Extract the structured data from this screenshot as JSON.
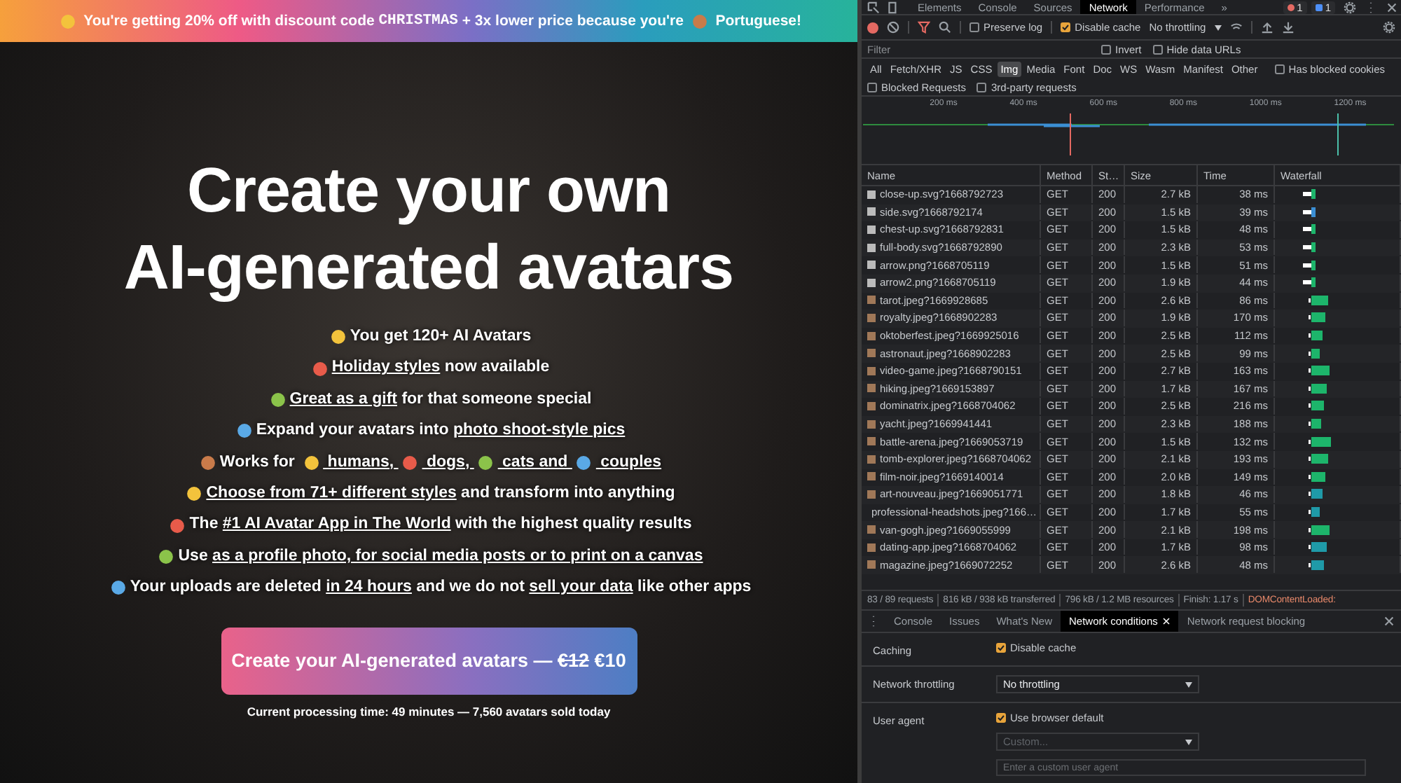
{
  "promo_banner": {
    "segments": [
      {
        "kind": "emoji"
      },
      {
        "kind": "text",
        "text": " You're getting 20% off with discount code "
      },
      {
        "kind": "code",
        "text": "CHRISTMAS"
      },
      {
        "kind": "text",
        "text": " + 3x lower price because you're "
      },
      {
        "kind": "emoji"
      },
      {
        "kind": "text",
        "text": " Portuguese!"
      }
    ]
  },
  "hero": {
    "title_lines": [
      "Create your own",
      "AI-generated avatars"
    ],
    "features": [
      {
        "segments": [
          {
            "kind": "text",
            "text": "You get 120+ AI Avatars"
          }
        ]
      },
      {
        "segments": [
          {
            "kind": "link",
            "text": "Holiday styles"
          },
          {
            "kind": "text",
            "text": " now available"
          }
        ]
      },
      {
        "segments": [
          {
            "kind": "link",
            "text": "Great as a gift"
          },
          {
            "kind": "text",
            "text": " for that someone special"
          }
        ]
      },
      {
        "segments": [
          {
            "kind": "text",
            "text": "Expand your avatars into "
          },
          {
            "kind": "link",
            "text": "photo shoot-style pics"
          }
        ]
      },
      {
        "segments": [
          {
            "kind": "text",
            "text": "Works for "
          },
          {
            "kind": "emoji"
          },
          {
            "kind": "link",
            "text": " humans, "
          },
          {
            "kind": "emoji"
          },
          {
            "kind": "link",
            "text": " dogs, "
          },
          {
            "kind": "emoji"
          },
          {
            "kind": "link",
            "text": " cats and "
          },
          {
            "kind": "emoji"
          },
          {
            "kind": "link",
            "text": " couples"
          }
        ]
      },
      {
        "segments": [
          {
            "kind": "link",
            "text": "Choose from 71+ different styles"
          },
          {
            "kind": "text",
            "text": " and transform into anything"
          }
        ]
      },
      {
        "segments": [
          {
            "kind": "text",
            "text": "The "
          },
          {
            "kind": "link",
            "text": "#1 AI Avatar App in The World"
          },
          {
            "kind": "text",
            "text": " with the highest quality results"
          }
        ]
      },
      {
        "segments": [
          {
            "kind": "text",
            "text": "Use "
          },
          {
            "kind": "link",
            "text": "as a profile photo, for social media posts or to print on a canvas"
          }
        ]
      },
      {
        "segments": [
          {
            "kind": "text",
            "text": "Your uploads are deleted "
          },
          {
            "kind": "link",
            "text": "in 24 hours"
          },
          {
            "kind": "text",
            "text": " and we do not "
          },
          {
            "kind": "link",
            "text": "sell your data"
          },
          {
            "kind": "text",
            "text": " like other apps"
          }
        ]
      }
    ],
    "cta_button": {
      "segments": [
        {
          "kind": "text",
          "text": "Create your AI-generated avatars — "
        },
        {
          "kind": "strike",
          "text": "€12"
        },
        {
          "kind": "text",
          "text": " €10"
        }
      ]
    },
    "note": "Current processing time: 49 minutes — 7,560 avatars sold today"
  },
  "devtools": {
    "tabs": [
      {
        "label": "Elements",
        "selected": false
      },
      {
        "label": "Console",
        "selected": false
      },
      {
        "label": "Sources",
        "selected": false
      },
      {
        "label": "Network",
        "selected": true
      },
      {
        "label": "Performance",
        "selected": false
      }
    ],
    "more_tabs": "»",
    "error_count": "1",
    "message_count": "1",
    "toolbar": {
      "preserve_log": {
        "label": "Preserve log",
        "checked": false
      },
      "disable_cache": {
        "label": "Disable cache",
        "checked": true
      },
      "throttling": "No throttling"
    },
    "filter": {
      "placeholder": "Filter",
      "invert": {
        "label": "Invert",
        "checked": false
      },
      "hide_data_urls": {
        "label": "Hide data URLs",
        "checked": false
      }
    },
    "type_filters": [
      {
        "label": "All",
        "selected": false
      },
      {
        "label": "Fetch/XHR",
        "selected": false
      },
      {
        "label": "JS",
        "selected": false
      },
      {
        "label": "CSS",
        "selected": false
      },
      {
        "label": "Img",
        "selected": true
      },
      {
        "label": "Media",
        "selected": false
      },
      {
        "label": "Font",
        "selected": false
      },
      {
        "label": "Doc",
        "selected": false
      },
      {
        "label": "WS",
        "selected": false
      },
      {
        "label": "Wasm",
        "selected": false
      },
      {
        "label": "Manifest",
        "selected": false
      },
      {
        "label": "Other",
        "selected": false
      }
    ],
    "has_blocked_cookies": {
      "label": "Has blocked cookies",
      "checked": false
    },
    "blocked_requests": {
      "label": "Blocked Requests",
      "checked": false
    },
    "third_party": {
      "label": "3rd-party requests",
      "checked": false
    },
    "timeline_ticks": [
      "200 ms",
      "400 ms",
      "600 ms",
      "800 ms",
      "1000 ms",
      "1200 ms"
    ],
    "table": {
      "columns": [
        "Name",
        "Method",
        "St…",
        "Size",
        "Time",
        "Waterfall"
      ],
      "rows": [
        {
          "name": "close-up.svg?1668792723",
          "method": "GET",
          "status": "200",
          "size": "2.7 kB",
          "time": "38 ms"
        },
        {
          "name": "side.svg?1668792174",
          "method": "GET",
          "status": "200",
          "size": "1.5 kB",
          "time": "39 ms"
        },
        {
          "name": "chest-up.svg?1668792831",
          "method": "GET",
          "status": "200",
          "size": "1.5 kB",
          "time": "48 ms"
        },
        {
          "name": "full-body.svg?1668792890",
          "method": "GET",
          "status": "200",
          "size": "2.3 kB",
          "time": "53 ms"
        },
        {
          "name": "arrow.png?1668705119",
          "method": "GET",
          "status": "200",
          "size": "1.5 kB",
          "time": "51 ms"
        },
        {
          "name": "arrow2.png?1668705119",
          "method": "GET",
          "status": "200",
          "size": "1.9 kB",
          "time": "44 ms"
        },
        {
          "name": "tarot.jpeg?1669928685",
          "method": "GET",
          "status": "200",
          "size": "2.6 kB",
          "time": "86 ms"
        },
        {
          "name": "royalty.jpeg?1668902283",
          "method": "GET",
          "status": "200",
          "size": "1.9 kB",
          "time": "170 ms"
        },
        {
          "name": "oktoberfest.jpeg?1669925016",
          "method": "GET",
          "status": "200",
          "size": "2.5 kB",
          "time": "112 ms"
        },
        {
          "name": "astronaut.jpeg?1668902283",
          "method": "GET",
          "status": "200",
          "size": "2.5 kB",
          "time": "99 ms"
        },
        {
          "name": "video-game.jpeg?1668790151",
          "method": "GET",
          "status": "200",
          "size": "2.7 kB",
          "time": "163 ms"
        },
        {
          "name": "hiking.jpeg?1669153897",
          "method": "GET",
          "status": "200",
          "size": "1.7 kB",
          "time": "167 ms"
        },
        {
          "name": "dominatrix.jpeg?1668704062",
          "method": "GET",
          "status": "200",
          "size": "2.5 kB",
          "time": "216 ms"
        },
        {
          "name": "yacht.jpeg?1669941441",
          "method": "GET",
          "status": "200",
          "size": "2.3 kB",
          "time": "188 ms"
        },
        {
          "name": "battle-arena.jpeg?1669053719",
          "method": "GET",
          "status": "200",
          "size": "1.5 kB",
          "time": "132 ms"
        },
        {
          "name": "tomb-explorer.jpeg?1668704062",
          "method": "GET",
          "status": "200",
          "size": "2.1 kB",
          "time": "193 ms"
        },
        {
          "name": "film-noir.jpeg?1669140014",
          "method": "GET",
          "status": "200",
          "size": "2.0 kB",
          "time": "149 ms"
        },
        {
          "name": "art-nouveau.jpeg?1669051771",
          "method": "GET",
          "status": "200",
          "size": "1.8 kB",
          "time": "46 ms"
        },
        {
          "name": "professional-headshots.jpeg?166…",
          "method": "GET",
          "status": "200",
          "size": "1.7 kB",
          "time": "55 ms"
        },
        {
          "name": "van-gogh.jpeg?1669055999",
          "method": "GET",
          "status": "200",
          "size": "2.1 kB",
          "time": "198 ms"
        },
        {
          "name": "dating-app.jpeg?1668704062",
          "method": "GET",
          "status": "200",
          "size": "1.7 kB",
          "time": "98 ms"
        },
        {
          "name": "magazine.jpeg?1669072252",
          "method": "GET",
          "status": "200",
          "size": "2.6 kB",
          "time": "48 ms"
        }
      ]
    },
    "status_bar": [
      {
        "kind": "stat",
        "text": "83 / 89 requests"
      },
      {
        "kind": "stat",
        "text": "816 kB / 938 kB transferred"
      },
      {
        "kind": "stat",
        "text": "796 kB / 1.2 MB resources"
      },
      {
        "kind": "stat",
        "text": "Finish: 1.17 s"
      },
      {
        "kind": "event",
        "text": "DOMContentLoaded:"
      }
    ],
    "drawer": {
      "tabs": [
        {
          "label": "Console",
          "selected": false,
          "closable": false
        },
        {
          "label": "Issues",
          "selected": false,
          "closable": false
        },
        {
          "label": "What's New",
          "selected": false,
          "closable": false
        },
        {
          "label": "Network conditions",
          "selected": true,
          "closable": true
        },
        {
          "label": "Network request blocking",
          "selected": false,
          "closable": false
        }
      ],
      "settings": [
        {
          "kind": "checkbox",
          "label": "Caching",
          "option": "Disable cache",
          "checked": true
        },
        {
          "kind": "select",
          "label": "Network throttling",
          "value": "No throttling"
        },
        {
          "kind": "user_agent",
          "label": "User agent",
          "option": "Use browser default",
          "checked": true,
          "select_value": "Custom...",
          "placeholder": "Enter a custom user agent"
        }
      ]
    }
  }
}
